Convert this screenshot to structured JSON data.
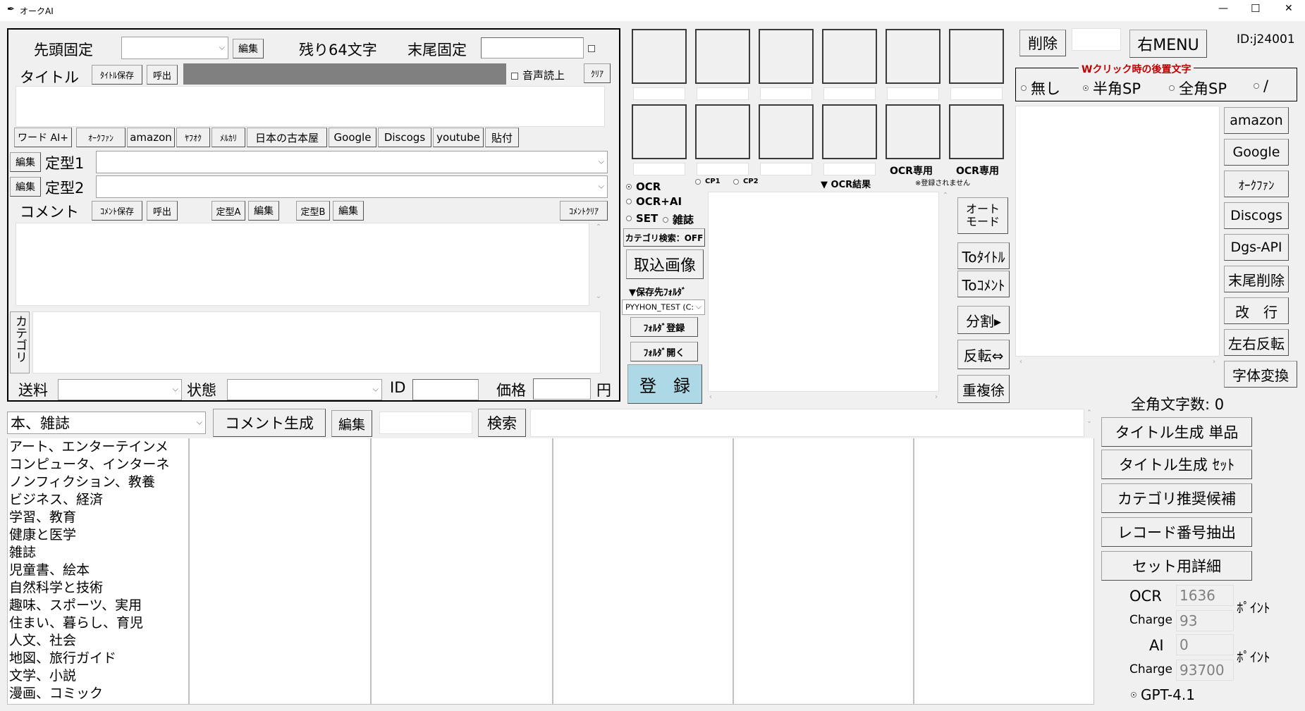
{
  "window": {
    "title": "オークAI",
    "minimize": "—",
    "maximize": "☐",
    "close": "✕"
  },
  "form": {
    "head_fix_label": "先頭固定",
    "head_edit": "編集",
    "remaining": "残り64文字",
    "tail_fix_label": "末尾固定",
    "title_label": "タイトル",
    "title_save": "ﾀｲﾄﾙ保存",
    "title_call": "呼出",
    "tts_label": "音声読上",
    "clear": "ｸﾘｱ",
    "links": [
      "ワード AI+",
      "ｵｰｸﾌｧﾝ",
      "amazon",
      "ﾔﾌｵｸ",
      "ﾒﾙｶﾘ",
      "日本の古本屋",
      "Google",
      "Discogs",
      "youtube",
      "貼付"
    ],
    "fixed1_edit": "編集",
    "fixed1_label": "定型1",
    "fixed2_edit": "編集",
    "fixed2_label": "定型2",
    "comment_label": "コメント",
    "comment_save": "ｺﾒﾝﾄ保存",
    "comment_call": "呼出",
    "fixedA": "定型A",
    "fixedA_edit": "編集",
    "fixedB": "定型B",
    "fixedB_edit": "編集",
    "comment_clear": "ｺﾒﾝﾄｸﾘｱ",
    "category_label": "カテゴリ",
    "shipping_label": "送料",
    "condition_label": "状態",
    "id_label": "ID",
    "price_label": "価格",
    "yen": "円"
  },
  "ocr": {
    "ocr_only_1": "OCR専用",
    "ocr_only_2": "OCR専用",
    "not_registered": "※登録されません",
    "modes": [
      "OCR",
      "OCR+AI",
      "SET"
    ],
    "magazine": "雑誌",
    "cp1": "CP1",
    "cp2": "CP2",
    "result_label": "▼ OCR結果",
    "category_search": "カテゴリ検索：OFF",
    "import_image": "取込画像",
    "save_folder_label": "▼保存先ﾌｫﾙﾀﾞ",
    "folder_value": "PYYHON_TEST (C:",
    "folder_register": "ﾌｫﾙﾀﾞ登録",
    "folder_open": "ﾌｫﾙﾀﾞ開く",
    "register": "登　録",
    "auto_mode": "オート\nモード",
    "to_title": "Toﾀｲﾄﾙ",
    "to_comment": "Toｺﾒﾝﾄ",
    "split": "分割▸",
    "reverse": "反転⇔",
    "dup_remove": "重複徐"
  },
  "right": {
    "delete": "削除",
    "right_menu": "右MENU",
    "user_id": "ID:j24001",
    "suffix_group": "Wクリック時の後置文字",
    "suffix_options": [
      "無し",
      "半角SP",
      "全角SP",
      "/"
    ],
    "tools": [
      "amazon",
      "Google",
      "ｵｰｸﾌｧﾝ",
      "Discogs",
      "Dgs-API",
      "末尾削除",
      "改　行",
      "左右反転",
      "字体変換"
    ],
    "zen_count": "全角文字数: 0",
    "actions": [
      "タイトル生成 単品",
      "タイトル生成 ｾｯﾄ",
      "カテゴリ推奨候補",
      "レコード番号抽出",
      "セット用詳細"
    ],
    "ocr_label": "OCR",
    "ocr_points": "1636",
    "point_unit": "ﾎﾟｲﾝﾄ",
    "charge_label": "Charge",
    "ocr_charge": "93",
    "ai_label": "AI",
    "ai_points": "0",
    "ai_charge": "93700",
    "model": "GPT-4.1"
  },
  "bottom": {
    "genre": "本、雑誌",
    "comment_gen": "コメント生成",
    "edit": "編集",
    "search": "検索",
    "categories": [
      "アート、エンターテインメ",
      "コンピュータ、インターネ",
      "ノンフィクション、教養",
      "ビジネス、経済",
      "学習、教育",
      "健康と医学",
      "雑誌",
      "児童書、絵本",
      "自然科学と技術",
      "趣味、スポーツ、実用",
      "住まい、暮らし、育児",
      "人文、社会",
      "地図、旅行ガイド",
      "文学、小説",
      "漫画、コミック"
    ]
  }
}
